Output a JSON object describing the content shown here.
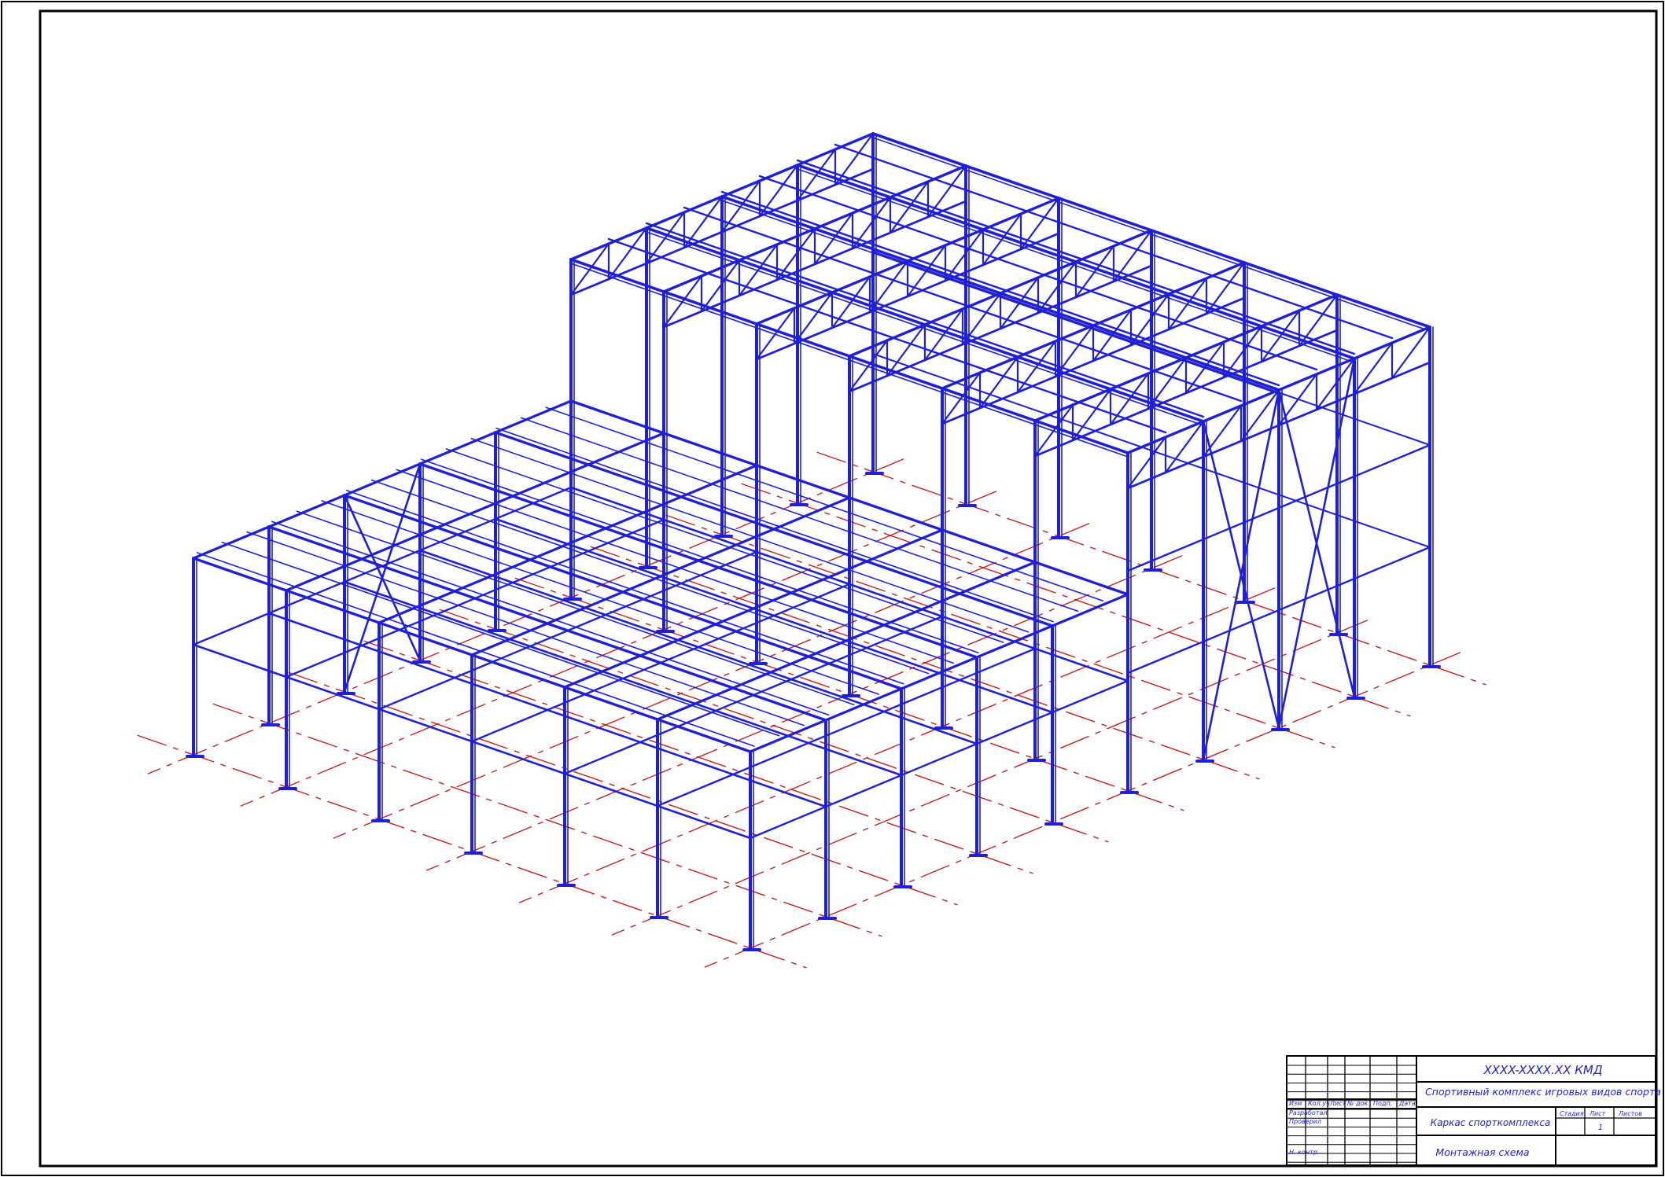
{
  "drawing": {
    "colors": {
      "steel": "#1f1fd6",
      "axes": "#c61f1f",
      "frame": "#000000"
    }
  },
  "title_block": {
    "designation": "XXXX-XXXX.XX КМД",
    "project": "Спортивный комплекс игровых видов спорта",
    "sheet_title": "Каркас спорткомплекса",
    "drawing_name": "Монтажная схема",
    "headers": {
      "change": "Изм",
      "count": "Кол.уч",
      "sheet": "Лист",
      "doc_no": "№ док.",
      "signature": "Подп.",
      "date": "Дата"
    },
    "roles": {
      "developed": "Разработал",
      "checked": "Проверил",
      "norm_control": "Н. контр."
    },
    "stage_label": "Стадия",
    "sheet_label": "Лист",
    "sheets_label": "Листов",
    "sheet_value": "1"
  }
}
